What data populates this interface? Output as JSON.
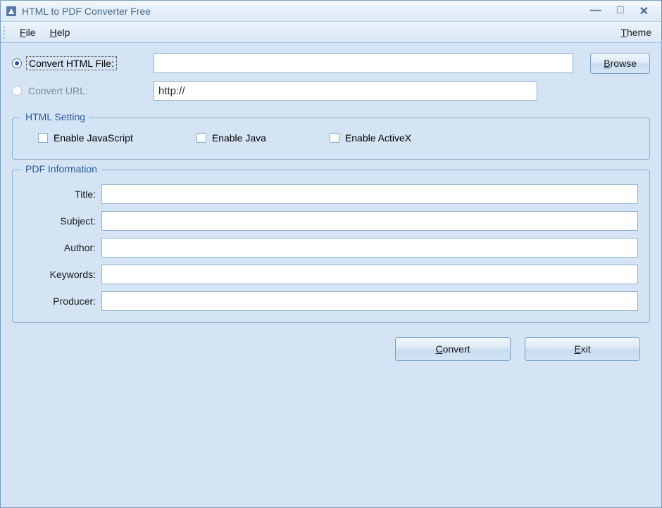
{
  "window": {
    "title": "HTML to PDF Converter Free"
  },
  "menubar": {
    "file": "File",
    "help": "Help",
    "theme": "Theme"
  },
  "source": {
    "convert_file_label": "Convert HTML File:",
    "convert_url_label": "Convert URL:",
    "file_value": "",
    "url_value": "http://",
    "browse_label": "Browse"
  },
  "html_setting": {
    "legend": "HTML Setting",
    "enable_js": "Enable JavaScript",
    "enable_java": "Enable Java",
    "enable_activex": "Enable ActiveX"
  },
  "pdf_info": {
    "legend": "PDF Information",
    "title_label": "Title:",
    "subject_label": "Subject:",
    "author_label": "Author:",
    "keywords_label": "Keywords:",
    "producer_label": "Producer:",
    "title_value": "",
    "subject_value": "",
    "author_value": "",
    "keywords_value": "",
    "producer_value": ""
  },
  "actions": {
    "convert": "Convert",
    "exit": "Exit"
  }
}
